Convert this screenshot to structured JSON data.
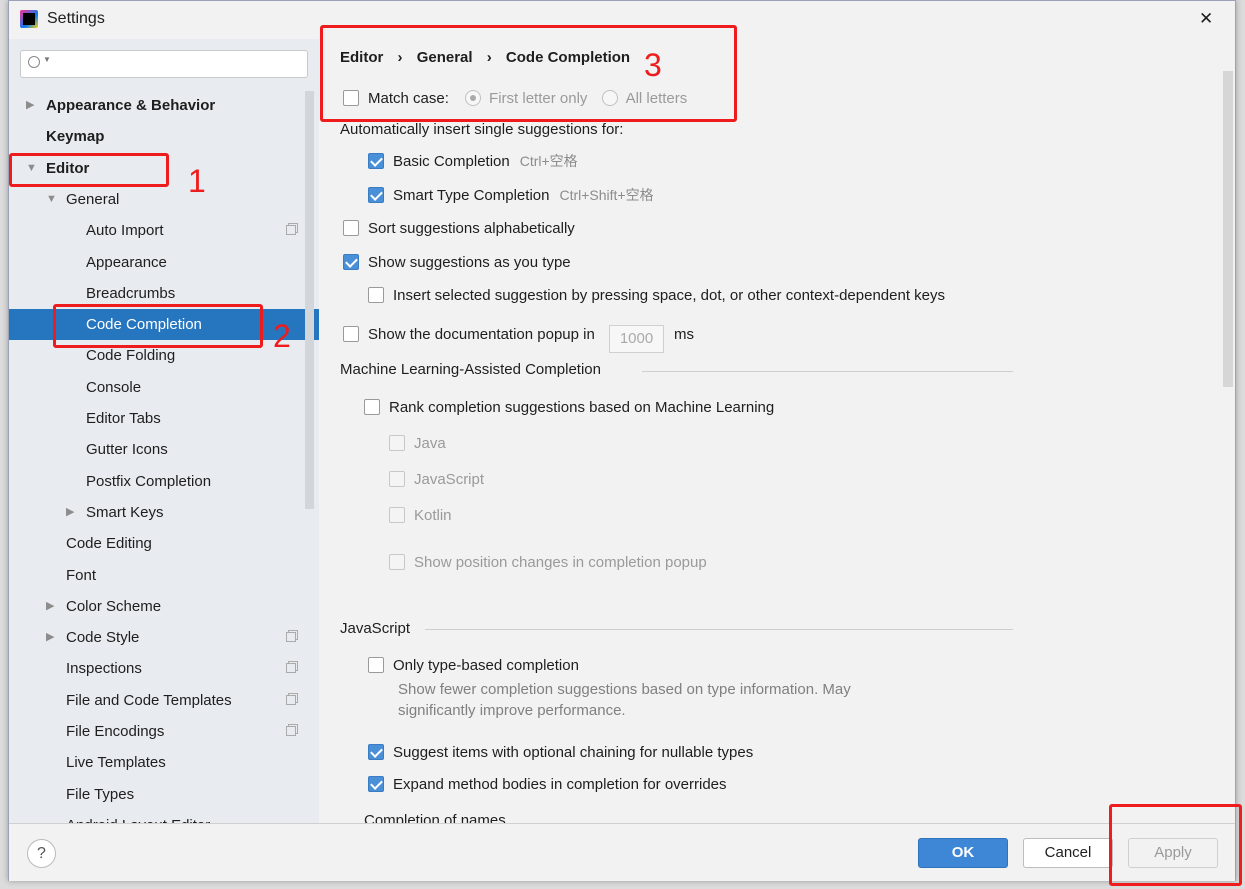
{
  "window": {
    "title": "Settings",
    "close": "✕"
  },
  "search": {
    "placeholder": ""
  },
  "tree": [
    {
      "label": "Appearance & Behavior",
      "level": 0,
      "bold": true,
      "arrow": "right"
    },
    {
      "label": "Keymap",
      "level": 0,
      "bold": true
    },
    {
      "label": "Editor",
      "level": 0,
      "bold": true,
      "arrow": "down"
    },
    {
      "label": "General",
      "level": 1,
      "arrow": "down"
    },
    {
      "label": "Auto Import",
      "level": 2,
      "copy": true
    },
    {
      "label": "Appearance",
      "level": 2
    },
    {
      "label": "Breadcrumbs",
      "level": 2
    },
    {
      "label": "Code Completion",
      "level": 2,
      "selected": true
    },
    {
      "label": "Code Folding",
      "level": 2
    },
    {
      "label": "Console",
      "level": 2
    },
    {
      "label": "Editor Tabs",
      "level": 2
    },
    {
      "label": "Gutter Icons",
      "level": 2
    },
    {
      "label": "Postfix Completion",
      "level": 2
    },
    {
      "label": "Smart Keys",
      "level": 2,
      "arrow": "right"
    },
    {
      "label": "Code Editing",
      "level": 1
    },
    {
      "label": "Font",
      "level": 1
    },
    {
      "label": "Color Scheme",
      "level": 1,
      "arrow": "right"
    },
    {
      "label": "Code Style",
      "level": 1,
      "arrow": "right",
      "copy": true
    },
    {
      "label": "Inspections",
      "level": 1,
      "copy": true
    },
    {
      "label": "File and Code Templates",
      "level": 1,
      "copy": true
    },
    {
      "label": "File Encodings",
      "level": 1,
      "copy": true
    },
    {
      "label": "Live Templates",
      "level": 1
    },
    {
      "label": "File Types",
      "level": 1
    },
    {
      "label": "Android Layout Editor",
      "level": 1
    }
  ],
  "breadcrumb": [
    "Editor",
    "General",
    "Code Completion"
  ],
  "breadcrumb_sep": "›",
  "match_case": {
    "label": "Match case:",
    "checked": false,
    "first": "First letter only",
    "all": "All letters",
    "selected": "First letter only"
  },
  "auto_insert_label": "Automatically insert single suggestions for:",
  "basic": {
    "label": "Basic Completion",
    "shortcut": "Ctrl+空格",
    "checked": true
  },
  "smart": {
    "label": "Smart Type Completion",
    "shortcut": "Ctrl+Shift+空格",
    "checked": true
  },
  "sort": {
    "label": "Sort suggestions alphabetically",
    "checked": false
  },
  "show_as_type": {
    "label": "Show suggestions as you type",
    "checked": true
  },
  "insert_selected": {
    "label": "Insert selected suggestion by pressing space, dot, or other context-dependent keys",
    "checked": false
  },
  "doc_popup": {
    "label": "Show the documentation popup in",
    "value": "1000",
    "unit": "ms",
    "checked": false
  },
  "ml": {
    "section": "Machine Learning-Assisted Completion",
    "rank": "Rank completion suggestions based on Machine Learning",
    "java": "Java",
    "javascript": "JavaScript",
    "kotlin": "Kotlin",
    "position": "Show position changes in completion popup"
  },
  "js": {
    "section": "JavaScript",
    "type_based": "Only type-based completion",
    "type_based_desc1": "Show fewer completion suggestions based on type information. May",
    "type_based_desc2": "significantly improve performance.",
    "optional_chaining": "Suggest items with optional chaining for nullable types",
    "expand_bodies": "Expand method bodies in completion for overrides",
    "names": "Completion of names"
  },
  "buttons": {
    "help": "?",
    "ok": "OK",
    "cancel": "Cancel",
    "apply": "Apply"
  },
  "annotations": [
    "1",
    "2",
    "3"
  ],
  "colors": {
    "accent": "#2675bf",
    "annotation": "#ee1c1c",
    "ok": "#3d87d6"
  }
}
